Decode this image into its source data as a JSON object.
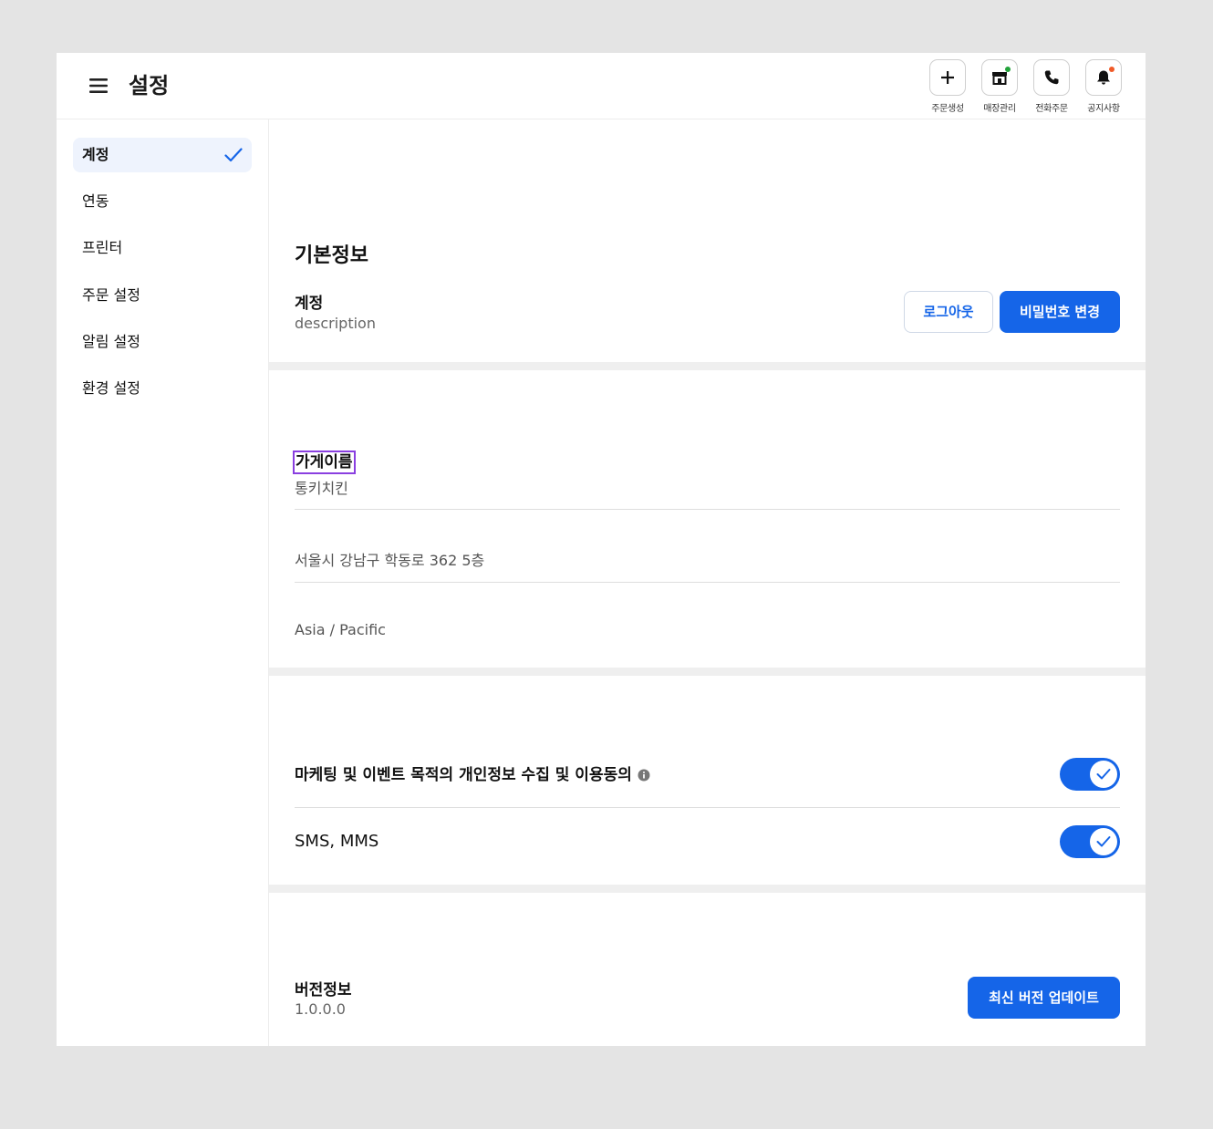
{
  "header": {
    "title": "설정",
    "quick_actions": [
      {
        "label": "주문생성",
        "icon": "plus-icon"
      },
      {
        "label": "매장관리",
        "icon": "store-icon",
        "badge_color": "#22a33a"
      },
      {
        "label": "전화주문",
        "icon": "phone-icon"
      },
      {
        "label": "공지사항",
        "icon": "bell-icon",
        "badge_color": "#f05a28"
      }
    ]
  },
  "sidebar": {
    "items": [
      {
        "label": "계정",
        "active": true
      },
      {
        "label": "연동"
      },
      {
        "label": "프린터"
      },
      {
        "label": "주문 설정"
      },
      {
        "label": "알림 설정"
      },
      {
        "label": "환경 설정"
      }
    ]
  },
  "basic_info": {
    "heading": "기본정보",
    "account_label": "계정",
    "account_description": "description",
    "logout_label": "로그아웃",
    "change_password_label": "비밀번호 변경"
  },
  "store": {
    "name_label": "가게이름",
    "name_value": "통키치킨",
    "address": "서울시 강남구 학동로 362 5층",
    "timezone": "Asia / Pacific"
  },
  "consent": {
    "marketing_label": "마케팅 및 이벤트 목적의 개인정보 수집 및 이용동의",
    "marketing_on": true,
    "sms_label": "SMS, MMS",
    "sms_on": true
  },
  "version": {
    "label": "버전정보",
    "value": "1.0.0.0",
    "update_label": "최신 버전 업데이트"
  },
  "colors": {
    "accent": "#1565e8",
    "focus_outline": "#8a3fe0",
    "page_background": "#e4e4e4"
  }
}
